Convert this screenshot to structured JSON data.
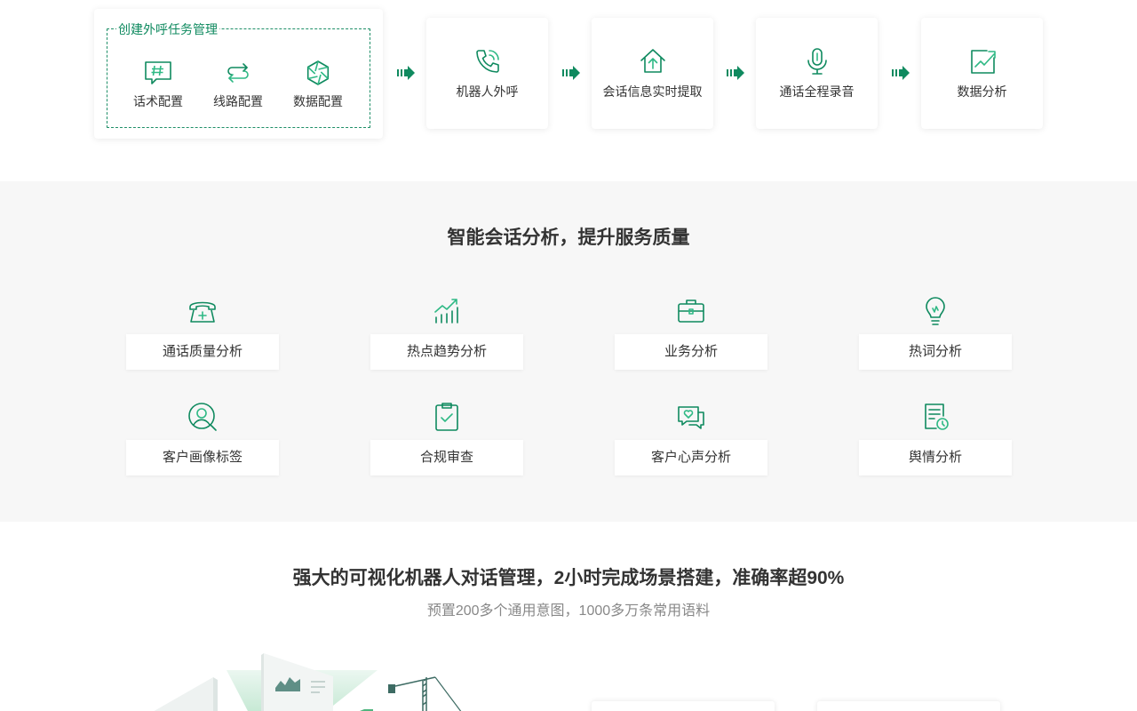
{
  "colors": {
    "accent": "#0f8a5f",
    "accent_light": "#2fb985",
    "bg_gray": "#f7f7f7"
  },
  "flow": {
    "create": {
      "title": "创建外呼任务管理",
      "items": [
        {
          "label": "话术配置",
          "icon": "hash-chat-icon"
        },
        {
          "label": "线路配置",
          "icon": "route-arrows-icon"
        },
        {
          "label": "数据配置",
          "icon": "aperture-icon"
        }
      ]
    },
    "steps": [
      {
        "label": "机器人外呼",
        "icon": "phone-icon"
      },
      {
        "label": "会话信息实时提取",
        "icon": "home-arrow-up-icon"
      },
      {
        "label": "通话全程录音",
        "icon": "microphone-icon"
      },
      {
        "label": "数据分析",
        "icon": "chart-trend-icon"
      }
    ]
  },
  "analysis": {
    "title": "智能会话分析，提升服务质量",
    "items": [
      {
        "label": "通话质量分析",
        "icon": "telephone-plus-icon"
      },
      {
        "label": "热点趋势分析",
        "icon": "bar-trend-icon"
      },
      {
        "label": "业务分析",
        "icon": "briefcase-icon"
      },
      {
        "label": "热词分析",
        "icon": "lightbulb-icon"
      },
      {
        "label": "客户画像标签",
        "icon": "user-search-icon"
      },
      {
        "label": "合规审查",
        "icon": "clipboard-check-icon"
      },
      {
        "label": "客户心声分析",
        "icon": "chat-heart-icon"
      },
      {
        "label": "舆情分析",
        "icon": "document-clock-icon"
      }
    ]
  },
  "dialog": {
    "title": "强大的可视化机器人对话管理，2小时完成场景搭建，准确率超90%",
    "subtitle": "预置200多个通用意图，1000多万条常用语料"
  }
}
